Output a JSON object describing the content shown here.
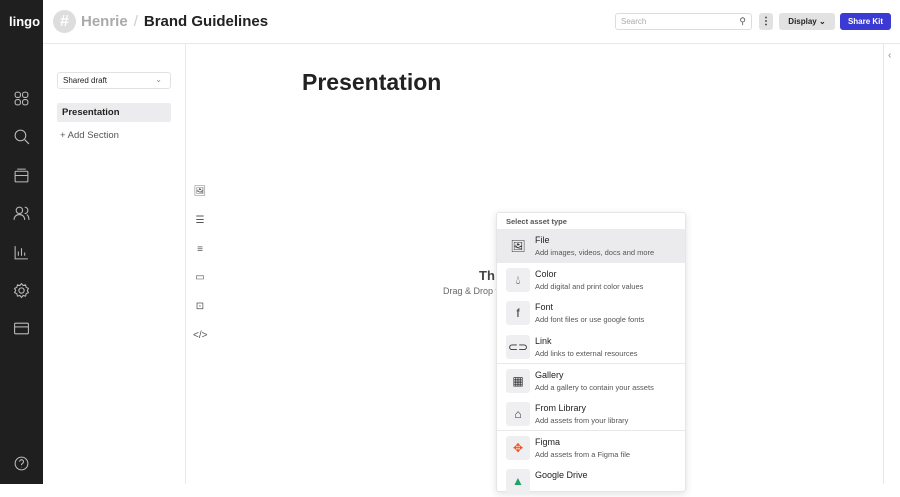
{
  "app": {
    "logo": "lingo"
  },
  "header": {
    "avatar_glyph": "#",
    "workspace": "Henrie",
    "separator": "/",
    "kit": "Brand Guidelines",
    "search_placeholder": "Search",
    "display_label": "Display",
    "share_label": "Share Kit"
  },
  "sidebar": {
    "version": "Shared draft",
    "sections": [
      "Presentation"
    ],
    "add_section": "Add Section"
  },
  "main": {
    "title": "Presentation",
    "empty_title_partial": "Th",
    "empty_sub_partial": "Drag & Drop t"
  },
  "menu": {
    "header": "Select asset type",
    "items": [
      {
        "label": "File",
        "desc": "Add images, videos, docs and more",
        "icon": "image-icon"
      },
      {
        "label": "Color",
        "desc": "Add digital and print color values",
        "icon": "droplet-icon"
      },
      {
        "label": "Font",
        "desc": "Add font files or use google fonts",
        "icon": "font-icon"
      },
      {
        "label": "Link",
        "desc": "Add links to external resources",
        "icon": "link-icon"
      },
      {
        "label": "Gallery",
        "desc": "Add a gallery to contain your assets",
        "icon": "grid-icon"
      },
      {
        "label": "From Library",
        "desc": "Add assets from your library",
        "icon": "archive-icon"
      },
      {
        "label": "Figma",
        "desc": "Add assets from a Figma file",
        "icon": "figma-icon"
      },
      {
        "label": "Google Drive",
        "desc": "",
        "icon": "google-drive-icon"
      }
    ]
  },
  "colors": {
    "accent": "#3b3bd3",
    "rail": "#1f1f1f"
  }
}
